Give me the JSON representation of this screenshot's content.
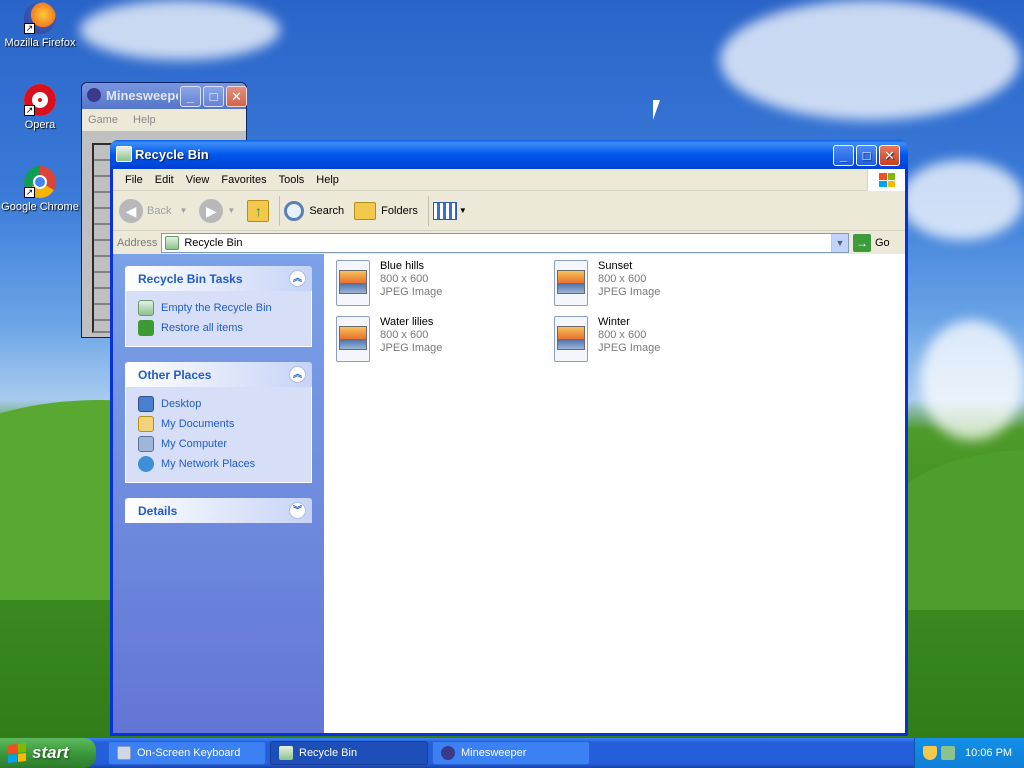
{
  "desktop": {
    "icons": [
      {
        "label": "Mozilla Firefox"
      },
      {
        "label": "Opera"
      },
      {
        "label": "Google Chrome"
      }
    ]
  },
  "minesweeper": {
    "title": "Minesweeper",
    "menu": [
      "Game",
      "Help"
    ]
  },
  "window": {
    "title": "Recycle Bin",
    "menu": [
      "File",
      "Edit",
      "View",
      "Favorites",
      "Tools",
      "Help"
    ],
    "toolbar": {
      "back": "Back",
      "search": "Search",
      "folders": "Folders"
    },
    "address": {
      "label": "Address",
      "value": "Recycle Bin",
      "go": "Go"
    }
  },
  "taskpane": {
    "tasks": {
      "title": "Recycle Bin Tasks",
      "items": [
        "Empty the Recycle Bin",
        "Restore all items"
      ]
    },
    "places": {
      "title": "Other Places",
      "items": [
        "Desktop",
        "My Documents",
        "My Computer",
        "My Network Places"
      ]
    },
    "details": {
      "title": "Details"
    }
  },
  "files": [
    {
      "name": "Blue hills",
      "dims": "800 x 600",
      "type": "JPEG Image"
    },
    {
      "name": "Sunset",
      "dims": "800 x 600",
      "type": "JPEG Image"
    },
    {
      "name": "Water lilies",
      "dims": "800 x 600",
      "type": "JPEG Image"
    },
    {
      "name": "Winter",
      "dims": "800 x 600",
      "type": "JPEG Image"
    }
  ],
  "taskbar": {
    "start": "start",
    "tasks": [
      "On-Screen Keyboard",
      "Recycle Bin",
      "Minesweeper"
    ],
    "clock": "10:06 PM"
  },
  "colors": {
    "title_blue": "#0058ee",
    "link_blue": "#215dc6",
    "taskpane": "#7ba2e7",
    "start_green": "#3c9a3c"
  }
}
